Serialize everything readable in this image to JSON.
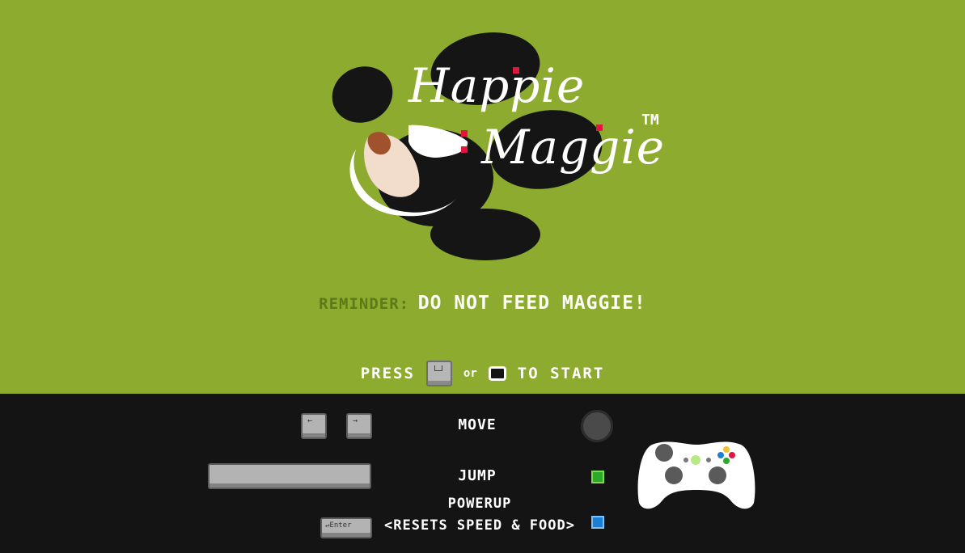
{
  "title": {
    "line1": "Happie",
    "line2": "Maggie",
    "trademark": "TM"
  },
  "reminder": {
    "label": "REMINDER:",
    "message": "DO NOT FEED MAGGIE!"
  },
  "start_prompt": {
    "press": "PRESS",
    "or": "or",
    "to_start": "TO START"
  },
  "controls": {
    "enter_key": "↵Enter",
    "move_label": "MOVE",
    "jump_label": "JUMP",
    "powerup_label": "POWERUP",
    "powerup_note": "<RESETS SPEED & FOOD>"
  },
  "colors": {
    "background": "#8dab2e",
    "panel": "#141414",
    "accent_red": "#e0163f",
    "button_a": "#2ea82b",
    "button_x": "#1c7fd4"
  }
}
